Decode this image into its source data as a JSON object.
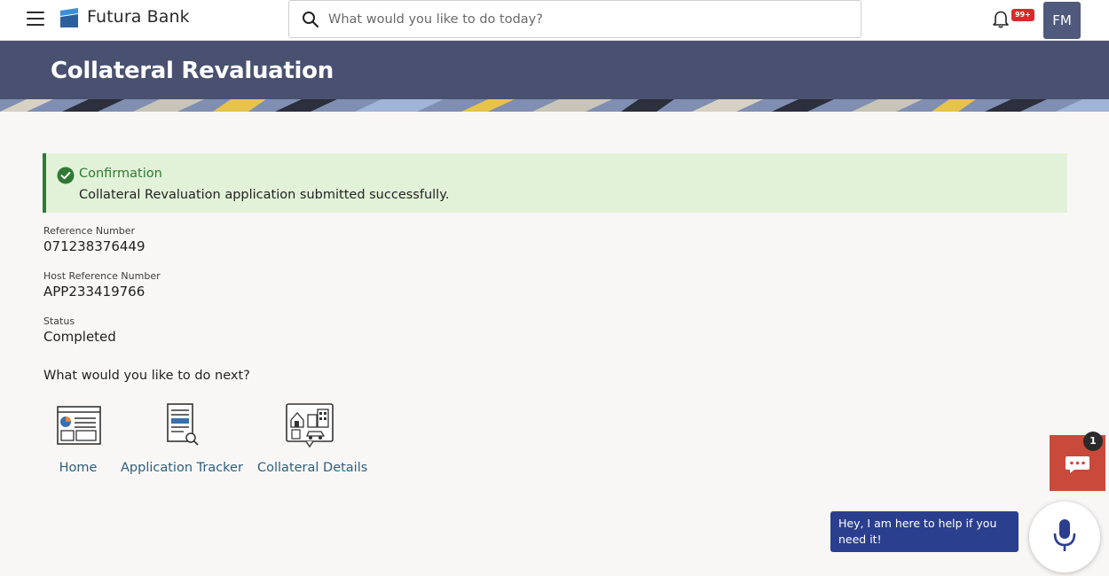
{
  "header": {
    "brand": "Futura Bank",
    "search_placeholder": "What would you like to do today?",
    "notification_badge": "99+",
    "avatar_initials": "FM"
  },
  "page": {
    "title": "Collateral Revaluation"
  },
  "confirmation": {
    "title": "Confirmation",
    "message": "Collateral Revaluation application submitted successfully."
  },
  "details": {
    "reference_label": "Reference Number",
    "reference_value": "071238376449",
    "host_reference_label": "Host Reference Number",
    "host_reference_value": "APP233419766",
    "status_label": "Status",
    "status_value": "Completed"
  },
  "next": {
    "title": "What would you like to do next?",
    "links": [
      {
        "label": "Home",
        "icon": "home-dashboard-icon"
      },
      {
        "label": "Application Tracker",
        "icon": "document-search-icon"
      },
      {
        "label": "Collateral Details",
        "icon": "collateral-property-icon"
      }
    ]
  },
  "chat": {
    "unread_count": "1",
    "assistant_message": "Hey, I am here to help if you need it!"
  },
  "colors": {
    "banner": "#4a5170",
    "confirm_bg": "#e2f2d8",
    "confirm_accent": "#2f7a34",
    "link": "#2e5f7e",
    "chat": "#c9493b",
    "assistant": "#2b3f8f"
  }
}
